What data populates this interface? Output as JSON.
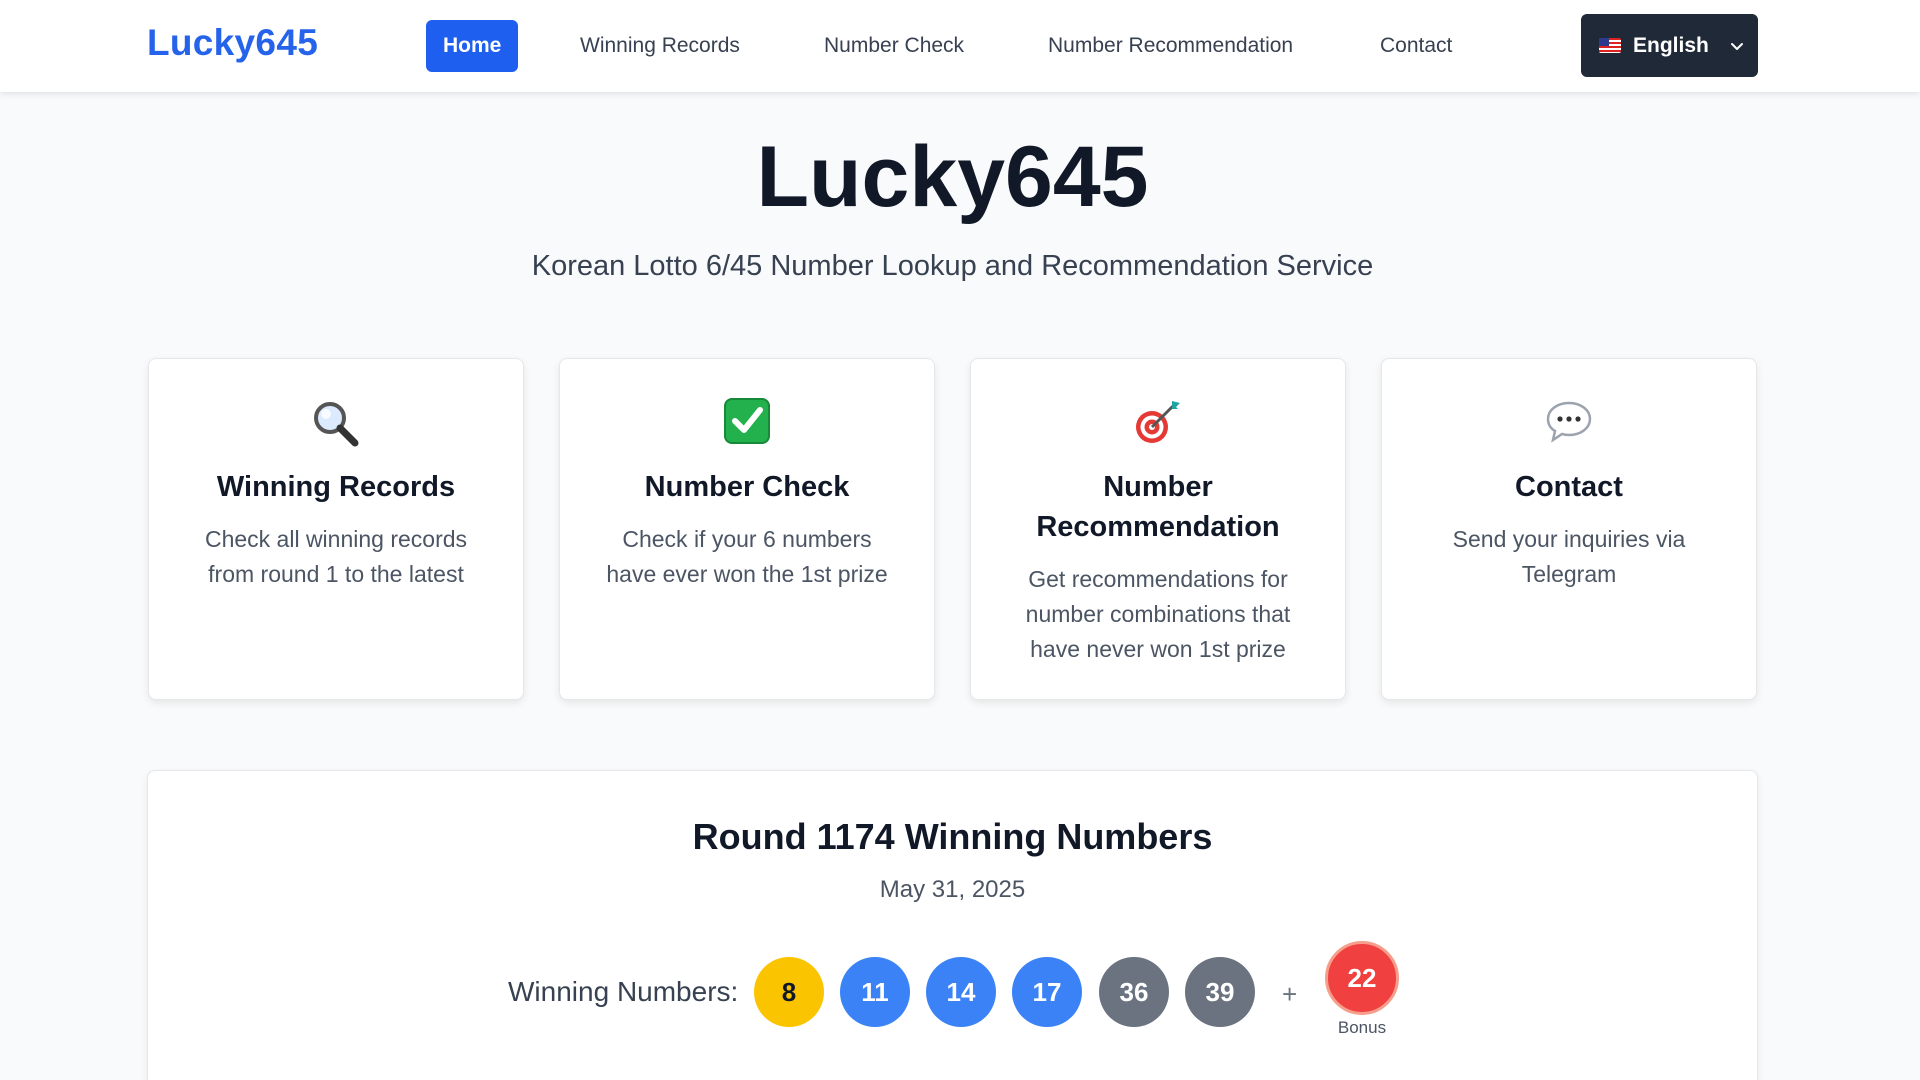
{
  "nav": {
    "logo": "Lucky645",
    "links": [
      "Home",
      "Winning Records",
      "Number Check",
      "Number Recommendation",
      "Contact"
    ],
    "active_index": 0,
    "language": "English"
  },
  "hero": {
    "title": "Lucky645",
    "subtitle": "Korean Lotto 6/45 Number Lookup and Recommendation Service"
  },
  "cards": [
    {
      "icon": "magnifier-icon",
      "title": "Winning Records",
      "desc_lines": [
        "Check all winning records",
        "from round 1 to the latest"
      ]
    },
    {
      "icon": "checkmark-icon",
      "title": "Number Check",
      "desc_lines": [
        "Check if your 6 numbers",
        "have ever won the 1st prize"
      ]
    },
    {
      "icon": "target-icon",
      "title_lines": [
        "Number",
        "Recommendation"
      ],
      "desc_lines": [
        "Get recommendations for",
        "number combinations that",
        "have never won 1st prize"
      ]
    },
    {
      "icon": "speech-bubble-icon",
      "title": "Contact",
      "desc_lines": [
        "Send your inquiries via",
        "Telegram"
      ]
    }
  ],
  "latest": {
    "title": "Round 1174 Winning Numbers",
    "date": "May 31, 2025",
    "label": "Winning Numbers:",
    "numbers": [
      "8",
      "11",
      "14",
      "17",
      "36",
      "39"
    ],
    "plus": "+",
    "bonus": "22",
    "bonus_label": "Bonus"
  },
  "colors": {
    "brand": "#2563eb",
    "nav_active": "#1f5ff0",
    "lang_button": "#1f2937",
    "ball_yellow": "#fbc400",
    "ball_blue": "#3b82f6",
    "ball_gray": "#6b7280",
    "ball_red": "#f04040"
  }
}
